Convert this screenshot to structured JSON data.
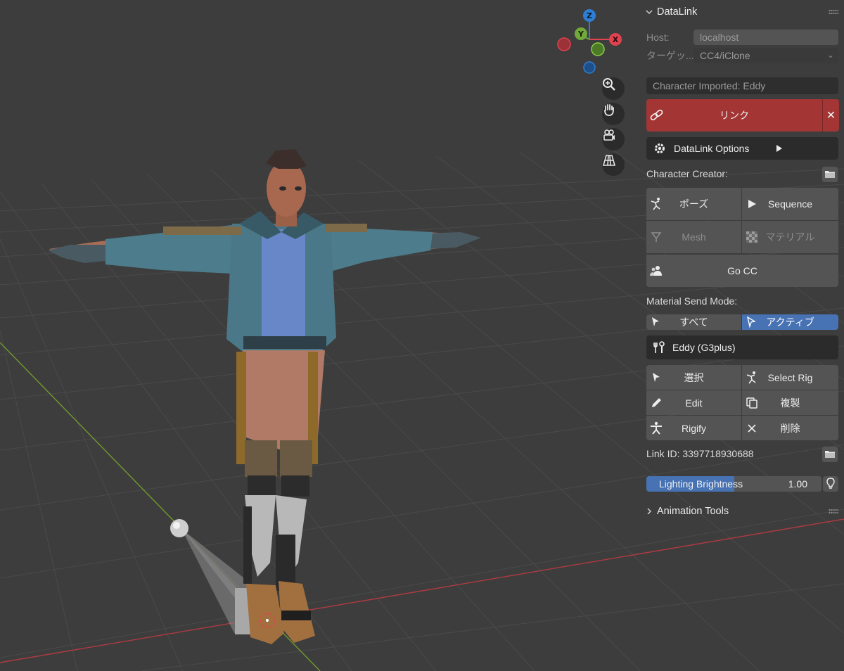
{
  "viewport": {
    "gizmo": {
      "x_label": "X",
      "y_label": "Y",
      "z_label": "Z"
    },
    "nav_buttons": [
      "zoom-icon",
      "hand-pan-icon",
      "camera-icon",
      "perspective-grid-icon"
    ]
  },
  "panel": {
    "title": "DataLink",
    "host_label": "Host:",
    "host_value": "localhost",
    "target_label": "ターゲッ...",
    "target_value": "CC4/iClone",
    "status": "Character Imported: Eddy",
    "link_label": "リンク",
    "close_glyph": "✕",
    "options_label": "DataLink Options",
    "character_creator_label": "Character Creator:",
    "cc_buttons": {
      "pose": "ポーズ",
      "sequence": "Sequence",
      "mesh": "Mesh",
      "material": "マテリアル",
      "go_cc": "Go CC"
    },
    "material_send_mode_label": "Material Send Mode:",
    "material_modes": {
      "all": "すべて",
      "active": "アクティブ",
      "selected": "アクティブ"
    },
    "character_name": "Eddy (G3plus)",
    "char_buttons": {
      "select": "選択",
      "select_rig": "Select Rig",
      "edit": "Edit",
      "duplicate": "複製",
      "rigify": "Rigify",
      "delete": "削除"
    },
    "link_id": "Link ID: 3397718930688",
    "lighting_label": "Lighting Brightness",
    "lighting_value": "1.00",
    "lighting_fraction": 0.5,
    "animation_tools_label": "Animation Tools"
  },
  "colors": {
    "link_red": "#a33535",
    "active_blue": "#4772b3",
    "axis_red": "#e0434f",
    "axis_green": "#73a83a",
    "axis_blue": "#2e7fd4"
  }
}
